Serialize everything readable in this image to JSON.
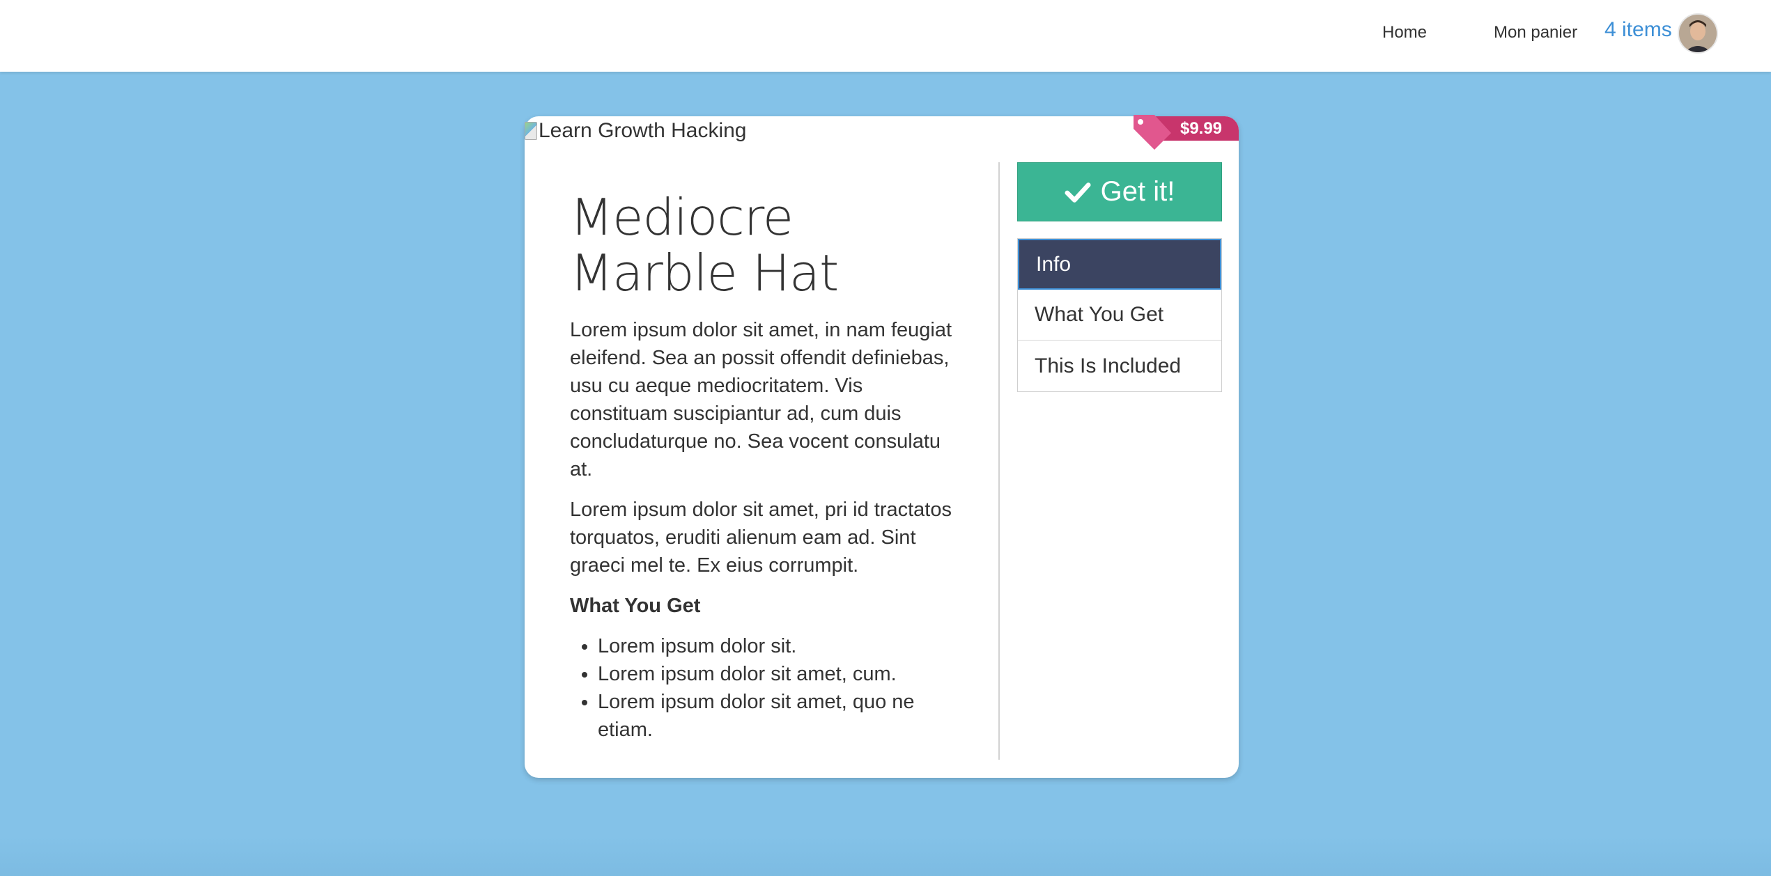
{
  "nav": {
    "home": "Home",
    "cart": "Mon panier",
    "items": "4 items"
  },
  "product": {
    "image_alt": "Learn Growth Hacking",
    "price": "$9.99",
    "title_line1": "Mediocre",
    "title_line2": "Marble Hat",
    "paragraphs": [
      "Lorem ipsum dolor sit amet, in nam feugiat eleifend. Sea an possit offendit definiebas, usu cu aeque mediocritatem. Vis constituam suscipiantur ad, cum duis concludaturque no. Sea vocent consulatu at.",
      "Lorem ipsum dolor sit amet, pri id tractatos torquatos, eruditi alienum eam ad. Sint graeci mel te. Ex eius corrumpit."
    ],
    "subheading": "What You Get",
    "bullets": [
      "Lorem ipsum dolor sit.",
      "Lorem ipsum dolor sit amet, cum.",
      "Lorem ipsum dolor sit amet, quo ne etiam."
    ]
  },
  "sidebar": {
    "get_button": "Get it!",
    "menu": [
      {
        "label": "Info",
        "active": true
      },
      {
        "label": "What You Get",
        "active": false
      },
      {
        "label": "This Is Included",
        "active": false
      }
    ]
  },
  "colors": {
    "background": "#84c2e8",
    "accent_green": "#3bb594",
    "menu_active": "#3b4461",
    "price_tag": "#c8356c",
    "link_blue": "#3d8fd6"
  },
  "icons": [
    "check-icon",
    "price-tag-icon",
    "broken-image-icon",
    "avatar"
  ]
}
